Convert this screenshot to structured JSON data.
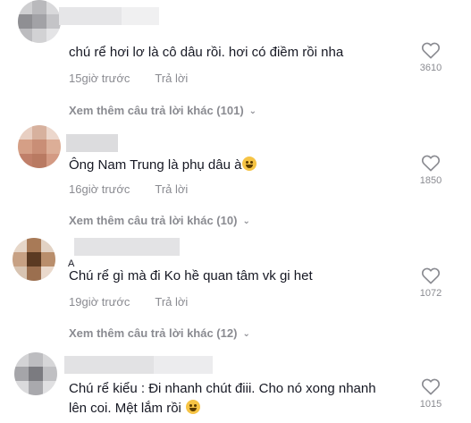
{
  "comments": [
    {
      "text": "chú rể hơi lơ là cô dâu rồi. hơi có điềm rồi nha",
      "time": "15giờ trước",
      "reply_label": "Trả lời",
      "likes": "3610",
      "more_replies": "Xem thêm câu trả lời khác (101)"
    },
    {
      "text": "Ông Nam Trung là phụ dâu à",
      "emoji": "grinning-sweat-emoji",
      "time": "16giờ trước",
      "reply_label": "Trả lời",
      "likes": "1850",
      "more_replies": "Xem thêm câu trả lời khác (10)"
    },
    {
      "name_prefix": "A",
      "text": "Chú rể gì mà đi Ko hề quan tâm vk gi het",
      "time": "19giờ trước",
      "reply_label": "Trả lời",
      "likes": "1072",
      "more_replies": "Xem thêm câu trả lời khác (12)"
    },
    {
      "text_line1": "Chú rể kiểu : Đi nhanh chút điii. Cho nó xong nhanh",
      "text_line2": "lên coi. Mệt lắm rồi",
      "emoji": "tired-face-emoji",
      "likes": "1015"
    }
  ],
  "icons": {
    "like": "heart-outline-icon",
    "expand": "chevron-down-icon"
  },
  "colors": {
    "text": "#161823",
    "muted": "#8a8b91"
  }
}
